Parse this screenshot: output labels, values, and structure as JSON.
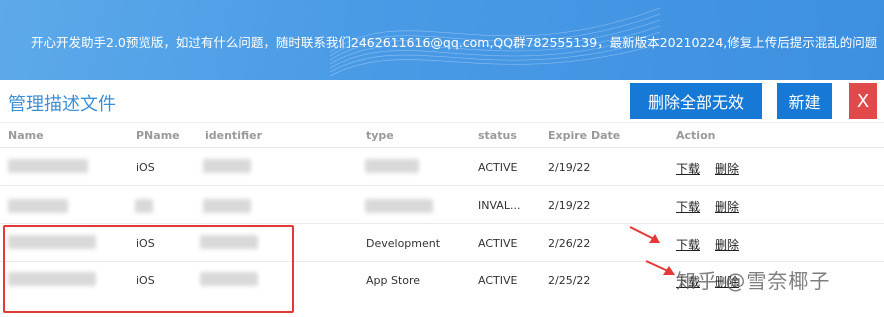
{
  "banner": {
    "text": "开心开发助手2.0预览版，如过有什么问题，随时联系我们2462611616@qq.com,QQ群782555139，最新版本20210224,修复上传后提示混乱的问题"
  },
  "toolbar": {
    "title": "管理描述文件",
    "delete_invalid_label": "删除全部无效",
    "new_label": "新建",
    "close_label": "X"
  },
  "table": {
    "headers": {
      "name": "Name",
      "pname": "PName",
      "identifier": "identifier",
      "type": "type",
      "status": "status",
      "expire": "Expire Date",
      "action": "Action"
    },
    "rows": [
      {
        "pname": "iOS",
        "type": "",
        "status": "ACTIVE",
        "expire": "2/19/22",
        "download": "下载",
        "delete": "删除"
      },
      {
        "pname": "",
        "type": "",
        "status": "INVAL...",
        "expire": "2/19/22",
        "download": "下载",
        "delete": "删除"
      },
      {
        "pname": "iOS",
        "type": "Development",
        "status": "ACTIVE",
        "expire": "2/26/22",
        "download": "下载",
        "delete": "删除"
      },
      {
        "pname": "iOS",
        "type": "App Store",
        "status": "ACTIVE",
        "expire": "2/25/22",
        "download": "下载",
        "delete": "删除"
      }
    ]
  },
  "watermark": {
    "text": "知乎 @雪奈椰子"
  },
  "colors": {
    "banner": "#4a9be6",
    "accent_button": "#1779d6",
    "close_button": "#e04a4a",
    "title": "#3b8fd6",
    "highlight": "#e53935"
  }
}
